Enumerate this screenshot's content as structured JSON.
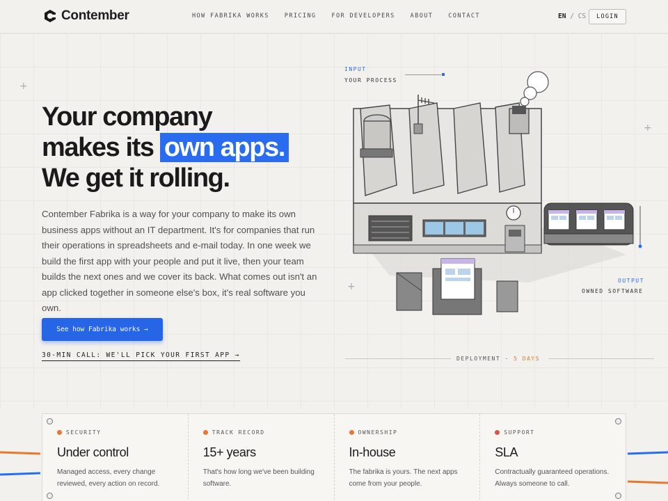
{
  "brand": {
    "name": "Contember"
  },
  "nav": {
    "items": [
      {
        "label": "HOW FABRIKA WORKS"
      },
      {
        "label": "PRICING"
      },
      {
        "label": "FOR DEVELOPERS"
      },
      {
        "label": "ABOUT"
      },
      {
        "label": "CONTACT"
      }
    ],
    "lang_active": "EN",
    "lang_sep": "/",
    "lang_other": "CS",
    "login": "LOGIN"
  },
  "hero": {
    "line1": "Your company",
    "line2_pre": "makes its",
    "line2_hl": "own apps.",
    "line3": "We get it rolling.",
    "description": "Contember Fabrika is a way for your company to make its own business apps without an IT department. It's for companies that run their operations in spreadsheets and e-mail today. In one week we build the first app with your people and put it live, then your team builds the next ones and we cover its back. What comes out isn't an app clicked together in someone else's box, it's real software you own.",
    "cta": "See how Fabrika works →",
    "call": "30-MIN CALL: WE'LL PICK YOUR FIRST APP →"
  },
  "illustration": {
    "input_label": "INPUT",
    "input_text": "YOUR PROCESS",
    "output_label": "OUTPUT",
    "output_text": "OWNED SOFTWARE",
    "deploy_label": "DEPLOYMENT",
    "deploy_sep": "·",
    "deploy_value": "5 DAYS"
  },
  "cards": [
    {
      "kicker": "SECURITY",
      "title": "Under control",
      "text": "Managed access, every change reviewed, every action on record.",
      "dot": "#e8782e"
    },
    {
      "kicker": "TRACK RECORD",
      "title": "15+ years",
      "text": "That's how long we've been building software.",
      "dot": "#e8782e"
    },
    {
      "kicker": "OWNERSHIP",
      "title": "In-house",
      "text": "The fabrika is yours. The next apps come from your people.",
      "dot": "#e8782e"
    },
    {
      "kicker": "SUPPORT",
      "title": "SLA",
      "text": "Contractually guaranteed operations. Always someone to call.",
      "dot": "#d9534f"
    }
  ],
  "colors": {
    "accent": "#2a6cef",
    "highlight": "#e8782e",
    "background": "#f2f1ee"
  }
}
